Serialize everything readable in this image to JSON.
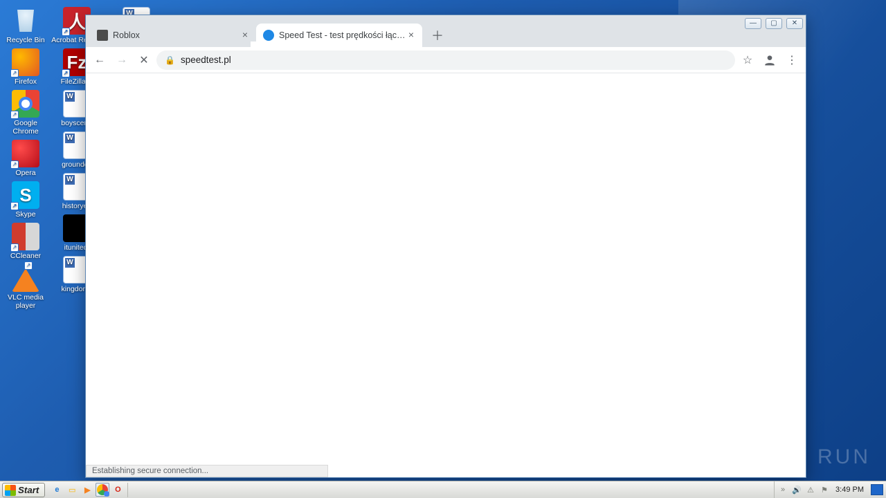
{
  "desktop": {
    "col1": [
      {
        "label": "Recycle Bin",
        "kind": "bin",
        "shortcut": false
      },
      {
        "label": "Firefox",
        "kind": "ff",
        "shortcut": true
      },
      {
        "label": "Google Chrome",
        "kind": "gc",
        "shortcut": true
      },
      {
        "label": "Opera",
        "kind": "op",
        "shortcut": true
      },
      {
        "label": "Skype",
        "kind": "sk",
        "shortcut": true
      },
      {
        "label": "CCleaner",
        "kind": "cc",
        "shortcut": true
      },
      {
        "label": "VLC media player",
        "kind": "vlc",
        "shortcut": true
      }
    ],
    "col2": [
      {
        "label": "Acrobat Reader",
        "kind": "pdf",
        "shortcut": true
      },
      {
        "label": "FileZilla C",
        "kind": "fz",
        "shortcut": true
      },
      {
        "label": "boyscerta",
        "kind": "wdoc",
        "shortcut": false
      },
      {
        "label": "groundco",
        "kind": "wdoc",
        "shortcut": false
      },
      {
        "label": "historyea",
        "kind": "wdoc",
        "shortcut": false
      },
      {
        "label": "itunited.",
        "kind": "blk",
        "shortcut": false
      },
      {
        "label": "kingdoms",
        "kind": "wdoc",
        "shortcut": false
      }
    ],
    "extra_top": {
      "label": "",
      "kind": "wdoc"
    }
  },
  "browser": {
    "tabs": [
      {
        "title": "Roblox",
        "active": false,
        "fav": "#4b4b4b"
      },
      {
        "title": "Speed Test - test prędkości łącza int",
        "active": true,
        "fav": "#1e88e5"
      }
    ],
    "new_tab_glyph": "＋",
    "nav": {
      "back": "←",
      "forward": "→",
      "stop": "✕"
    },
    "url": "speedtest.pl",
    "star": "☆",
    "profile": "◉",
    "menu": "⋮",
    "status": "Establishing secure connection..."
  },
  "window_controls": {
    "min": "—",
    "max": "▢",
    "close": "✕"
  },
  "watermark": {
    "text": "ANY   RUN"
  },
  "taskbar": {
    "start": "Start",
    "quicklaunch": [
      {
        "name": "ie",
        "color": "#1e7ad6",
        "glyph": "e"
      },
      {
        "name": "explorer",
        "color": "#f3c652",
        "glyph": "▭"
      },
      {
        "name": "wmp",
        "color": "#f58220",
        "glyph": "▶"
      },
      {
        "name": "chrome",
        "color": "#fff",
        "glyph": "gc",
        "active": true
      },
      {
        "name": "opera",
        "color": "#d62314",
        "glyph": "O"
      }
    ],
    "tray": {
      "chev": "»",
      "vol": "🔊",
      "net": "⚠",
      "flag": "⚑"
    },
    "clock": "3:49 PM"
  }
}
